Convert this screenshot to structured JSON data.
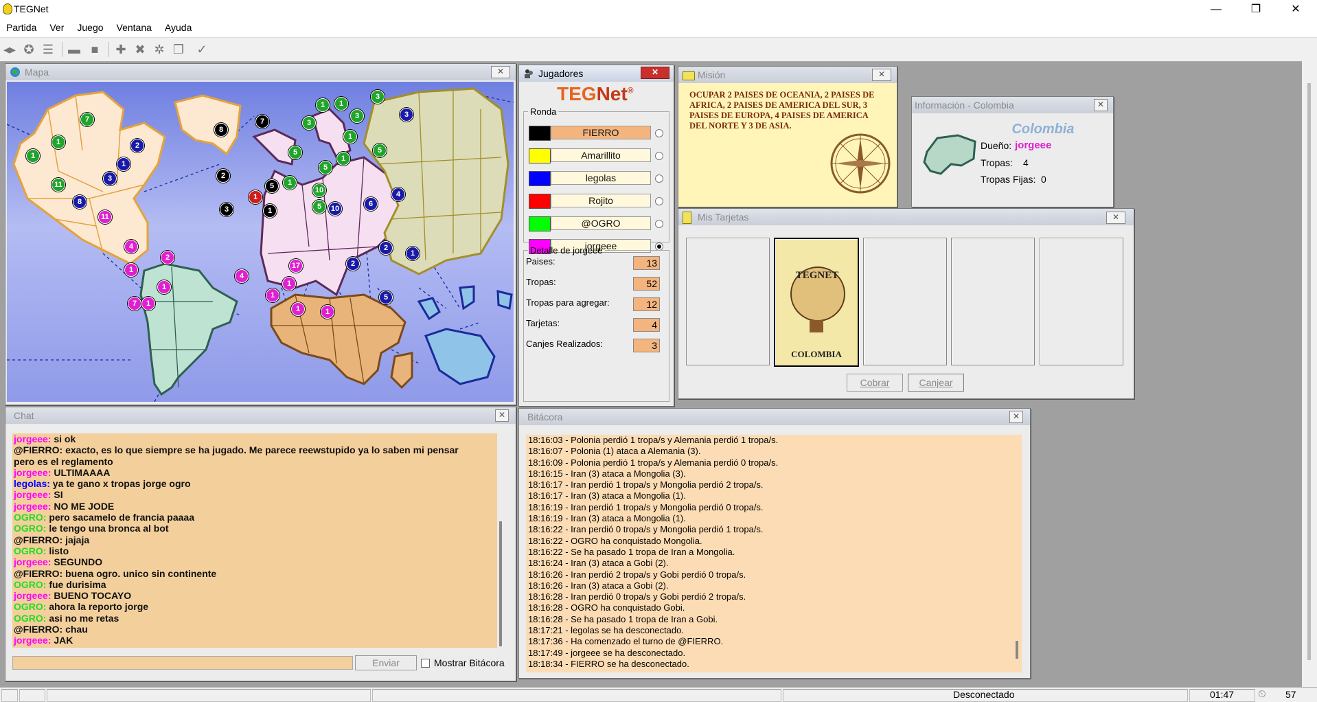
{
  "app": {
    "title": "TEGNet",
    "window_controls": {
      "minimize": "—",
      "restore": "❐",
      "close": "✕"
    }
  },
  "menu": [
    "Partida",
    "Ver",
    "Juego",
    "Ventana",
    "Ayuda"
  ],
  "toolbar_icons": [
    "connect-icon",
    "disconnect-icon",
    "list-icon",
    "board-icon",
    "stop-icon",
    "add-icon",
    "cross-icon",
    "gear-icon",
    "copy-icon",
    "check-icon"
  ],
  "map_window": {
    "title": "Mapa",
    "close": "✕"
  },
  "players_window": {
    "title": "Jugadores",
    "logo_a": "TEG",
    "logo_b": "Net",
    "logo_reg": "®",
    "round_label": "Ronda",
    "players": [
      {
        "name": "FIERRO",
        "color": "#000000",
        "highlight": "#f4b47e",
        "selected": false
      },
      {
        "name": "Amarillito",
        "color": "#ffff00",
        "highlight": "#fff8dc",
        "selected": false
      },
      {
        "name": "legolas",
        "color": "#0000ff",
        "highlight": "#fff8dc",
        "selected": false
      },
      {
        "name": "Rojito",
        "color": "#ff0000",
        "highlight": "#fff8dc",
        "selected": false
      },
      {
        "name": "@OGRO",
        "color": "#00ff00",
        "highlight": "#fff8dc",
        "selected": false
      },
      {
        "name": "jorgeee",
        "color": "#ff00ff",
        "highlight": "#fff8dc",
        "selected": true
      }
    ],
    "detail_label": "Detalle de jorgeee",
    "details": [
      {
        "label": "Paises:",
        "value": "13"
      },
      {
        "label": "Tropas:",
        "value": "52"
      },
      {
        "label": "Tropas para agregar:",
        "value": "12"
      },
      {
        "label": "Tarjetas:",
        "value": "4"
      },
      {
        "label": "Canjes Realizados:",
        "value": "3"
      }
    ]
  },
  "mission_window": {
    "title": "Misión",
    "text": "OCUPAR 2 PAISES DE OCEANIA, 2 PAISES DE AFRICA, 2 PAISES DE AMERICA DEL SUR, 3 PAISES DE EUROPA, 4 PAISES DE AMERICA DEL NORTE Y 3 DE ASIA."
  },
  "info_window": {
    "title": "Información - Colombia",
    "country": "Colombia",
    "owner_label": "Dueño:",
    "owner": "jorgeee",
    "troops_label": "Tropas:",
    "troops": "4",
    "fixed_label": "Tropas Fijas:",
    "fixed": "0"
  },
  "cards_window": {
    "title": "Mis Tarjetas",
    "card_logo": "TEGNET",
    "card_country": "COLOMBIA",
    "cobrar": "Cobrar",
    "canjear": "Canjear"
  },
  "chat_window": {
    "title": "Chat",
    "lines": [
      {
        "who": "jorgeee:",
        "color": "#ff00ff",
        "msg": " si ok"
      },
      {
        "who": "@FIERRO:",
        "color": "#111111",
        "msg": " exacto, es lo que siempre se ha jugado. Me parece reewstupido ya lo saben mi pensar"
      },
      {
        "who": "",
        "color": "#111111",
        "msg": "pero es el reglamento"
      },
      {
        "who": "jorgeee:",
        "color": "#ff00ff",
        "msg": " ULTIMAAAA"
      },
      {
        "who": "legolas:",
        "color": "#0000ff",
        "msg": " ya te gano x tropas jorge ogro"
      },
      {
        "who": "jorgeee:",
        "color": "#ff00ff",
        "msg": " SI"
      },
      {
        "who": "jorgeee:",
        "color": "#ff00ff",
        "msg": " NO ME JODE"
      },
      {
        "who": "OGRO:",
        "color": "#22dd22",
        "msg": " pero sacamelo de francia paaaa"
      },
      {
        "who": "OGRO:",
        "color": "#22dd22",
        "msg": " le tengo una bronca al bot"
      },
      {
        "who": "@FIERRO:",
        "color": "#111111",
        "msg": " jajaja"
      },
      {
        "who": "OGRO:",
        "color": "#22dd22",
        "msg": " listo"
      },
      {
        "who": "jorgeee:",
        "color": "#ff00ff",
        "msg": " SEGUNDO"
      },
      {
        "who": "@FIERRO:",
        "color": "#111111",
        "msg": " buena ogro. unico sin continente"
      },
      {
        "who": "OGRO:",
        "color": "#22dd22",
        "msg": " fue durisima"
      },
      {
        "who": "jorgeee:",
        "color": "#ff00ff",
        "msg": " BUENO TOCAYO"
      },
      {
        "who": "OGRO:",
        "color": "#22dd22",
        "msg": " ahora la reporto jorge"
      },
      {
        "who": "OGRO:",
        "color": "#22dd22",
        "msg": " asi no me retas"
      },
      {
        "who": "@FIERRO:",
        "color": "#111111",
        "msg": " chau"
      },
      {
        "who": "jorgeee:",
        "color": "#ff00ff",
        "msg": " JAK"
      }
    ],
    "input_value": "",
    "send": "Enviar",
    "show_log": "Mostrar Bitácora"
  },
  "log_window": {
    "title": "Bitácora",
    "lines": [
      "18:16:03 - Polonia perdió 1 tropa/s y Alemania perdió 1 tropa/s.",
      "18:16:07 - Polonia (1) ataca a Alemania (3).",
      "18:16:09 - Polonia perdió 1 tropa/s y Alemania perdió 0 tropa/s.",
      "18:16:15 - Iran (3) ataca a Mongolia (3).",
      "18:16:17 - Iran perdió 1 tropa/s y Mongolia perdió 2 tropa/s.",
      "18:16:17 - Iran (3) ataca a Mongolia (1).",
      "18:16:19 - Iran perdió 1 tropa/s y Mongolia perdió 0 tropa/s.",
      "18:16:19 - Iran (3) ataca a Mongolia (1).",
      "18:16:22 - Iran perdió 0 tropa/s y Mongolia perdió 1 tropa/s.",
      "18:16:22 - OGRO ha conquistado Mongolia.",
      "18:16:22 - Se ha pasado 1 tropa de Iran a Mongolia.",
      "18:16:24 - Iran (3) ataca a Gobi (2).",
      "18:16:26 - Iran perdió 2 tropa/s y Gobi perdió 0 tropa/s.",
      "18:16:26 - Iran (3) ataca a Gobi (2).",
      "18:16:28 - Iran perdió 0 tropa/s y Gobi perdió 2 tropa/s.",
      "18:16:28 - OGRO ha conquistado Gobi.",
      "18:16:28 - Se ha pasado 1 tropa de Iran a Gobi.",
      "18:17:21 - legolas se ha desconectado.",
      "18:17:36 - Ha comenzado el turno de @FIERRO.",
      "18:17:49 - jorgeee se ha desconectado.",
      "18:18:34 - FIERRO se ha desconectado."
    ]
  },
  "status": {
    "connection": "Desconectado",
    "time": "01:47",
    "count": "57"
  },
  "colors": {
    "black": "#000000",
    "green": "#1fa52a",
    "blue": "#1a1aa8",
    "magenta": "#e020d0",
    "red": "#d21a1a",
    "yellow": "#ffff00"
  },
  "map_markers": [
    {
      "n": "7",
      "c": "#1fa52a"
    },
    {
      "n": "1",
      "c": "#1fa52a"
    },
    {
      "n": "1",
      "c": "#1fa52a"
    },
    {
      "n": "11",
      "c": "#1fa52a"
    },
    {
      "n": "3",
      "c": "#1a1aa8"
    },
    {
      "n": "2",
      "c": "#1a1aa8"
    },
    {
      "n": "1",
      "c": "#1a1aa8"
    },
    {
      "n": "3",
      "c": "#1a1aa8"
    },
    {
      "n": "8",
      "c": "#1a1aa8"
    },
    {
      "n": "11",
      "c": "#e020d0"
    },
    {
      "n": "8",
      "c": "#000000"
    },
    {
      "n": "7",
      "c": "#000000"
    },
    {
      "n": "2",
      "c": "#000000"
    },
    {
      "n": "5",
      "c": "#000000"
    },
    {
      "n": "1",
      "c": "#d21a1a"
    },
    {
      "n": "3",
      "c": "#000000"
    },
    {
      "n": "1",
      "c": "#000000"
    },
    {
      "n": "1",
      "c": "#1fa52a"
    },
    {
      "n": "5",
      "c": "#1fa52a"
    },
    {
      "n": "5",
      "c": "#1fa52a"
    },
    {
      "n": "10",
      "c": "#1fa52a"
    },
    {
      "n": "5",
      "c": "#1fa52a"
    },
    {
      "n": "10",
      "c": "#1a1aa8"
    },
    {
      "n": "1",
      "c": "#1fa52a"
    },
    {
      "n": "1",
      "c": "#1fa52a"
    },
    {
      "n": "3",
      "c": "#1fa52a"
    },
    {
      "n": "3",
      "c": "#1fa52a"
    },
    {
      "n": "3",
      "c": "#1fa52a"
    },
    {
      "n": "1",
      "c": "#1fa52a"
    },
    {
      "n": "1",
      "c": "#1fa52a"
    },
    {
      "n": "5",
      "c": "#1fa52a"
    },
    {
      "n": "3",
      "c": "#1a1aa8"
    },
    {
      "n": "6",
      "c": "#1a1aa8"
    },
    {
      "n": "4",
      "c": "#1a1aa8"
    },
    {
      "n": "4",
      "c": "#e020d0"
    },
    {
      "n": "2",
      "c": "#e020d0"
    },
    {
      "n": "1",
      "c": "#e020d0"
    },
    {
      "n": "1",
      "c": "#e020d0"
    },
    {
      "n": "7",
      "c": "#e020d0"
    },
    {
      "n": "1",
      "c": "#e020d0"
    },
    {
      "n": "4",
      "c": "#e020d0"
    },
    {
      "n": "17",
      "c": "#e020d0"
    },
    {
      "n": "1",
      "c": "#e020d0"
    },
    {
      "n": "1",
      "c": "#e020d0"
    },
    {
      "n": "1",
      "c": "#e020d0"
    },
    {
      "n": "1",
      "c": "#e020d0"
    },
    {
      "n": "2",
      "c": "#1a1aa8"
    },
    {
      "n": "2",
      "c": "#1a1aa8"
    },
    {
      "n": "1",
      "c": "#1a1aa8"
    },
    {
      "n": "5",
      "c": "#1a1aa8"
    }
  ]
}
